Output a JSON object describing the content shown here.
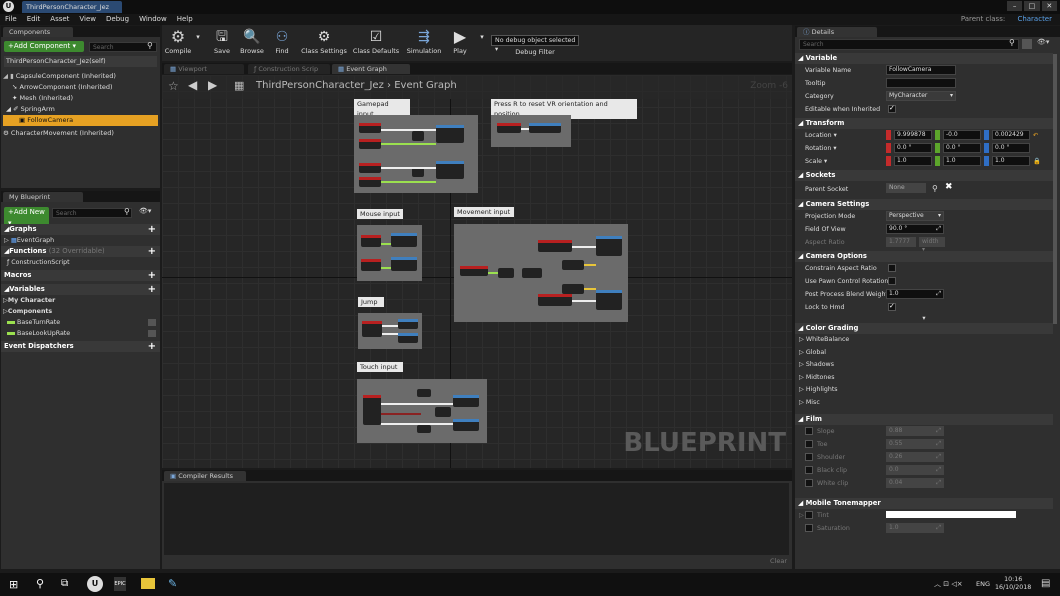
{
  "window": {
    "tab_title": "ThirdPersonCharacter_Jez",
    "parent_class_label": "Parent class:",
    "parent_class_value": "Character"
  },
  "menu": [
    "File",
    "Edit",
    "Asset",
    "View",
    "Debug",
    "Window",
    "Help"
  ],
  "components": {
    "tab": "Components",
    "add_button": "+Add Component ▾",
    "search_placeholder": "Search",
    "self": "ThirdPersonCharacter_Jez(self)",
    "items": [
      "CapsuleComponent (Inherited)",
      "ArrowComponent (Inherited)",
      "Mesh (Inherited)",
      "SpringArm",
      "FollowCamera",
      "CharacterMovement (Inherited)"
    ]
  },
  "blueprint": {
    "tab": "My Blueprint",
    "add_button": "+Add New ▾",
    "search_placeholder": "Search",
    "graphs": "Graphs",
    "event_graph": "EventGraph",
    "functions": "Functions",
    "functions_count": "(32 Overridable)",
    "construction_script": "ConstructionScript",
    "macros": "Macros",
    "variables": "Variables",
    "my_character": "My Character",
    "components": "Components",
    "var1": "BaseTurnRate",
    "var2": "BaseLookUpRate",
    "dispatchers": "Event Dispatchers"
  },
  "toolbar": {
    "compile": "Compile",
    "save": "Save",
    "browse": "Browse",
    "find": "Find",
    "class_settings": "Class Settings",
    "class_defaults": "Class Defaults",
    "simulation": "Simulation",
    "play": "Play",
    "debug_select": "No debug object selected ▾",
    "debug_filter": "Debug Filter"
  },
  "editor_tabs": [
    "Viewport",
    "Construction Scrip",
    "Event Graph"
  ],
  "graph": {
    "breadcrumb_root": "ThirdPersonCharacter_Jez",
    "breadcrumb_sep": "›",
    "breadcrumb_leaf": "Event Graph",
    "zoom": "Zoom -6",
    "watermark": "BLUEPRINT",
    "comments": [
      "Gamepad input",
      "Press R to reset VR orientation and position",
      "Mouse input",
      "Movement input",
      "Jump",
      "Touch input"
    ]
  },
  "compiler": {
    "tab": "Compiler Results",
    "clear": "Clear"
  },
  "details": {
    "tab": "Details",
    "search_placeholder": "Search",
    "variable": {
      "header": "Variable",
      "name_label": "Variable Name",
      "name_value": "FollowCamera",
      "tooltip_label": "Tooltip",
      "category_label": "Category",
      "category_value": "MyCharacter",
      "editable_label": "Editable when Inherited"
    },
    "transform": {
      "header": "Transform",
      "location": "Location ▾",
      "rotation": "Rotation ▾",
      "scale": "Scale ▾",
      "loc": [
        "9.999878",
        "-0.0",
        "0.002429"
      ],
      "rot": [
        "0.0 °",
        "0.0 °",
        "0.0 °"
      ],
      "scl": [
        "1.0",
        "1.0",
        "1.0"
      ]
    },
    "sockets": {
      "header": "Sockets",
      "parent_label": "Parent Socket",
      "parent_value": "None"
    },
    "camera_settings": {
      "header": "Camera Settings",
      "projection_label": "Projection Mode",
      "projection_value": "Perspective",
      "fov_label": "Field Of View",
      "fov_value": "90.0 °",
      "aspect_label": "Aspect Ratio",
      "aspect_value": "1.7777",
      "aspect_extra": "width ▾"
    },
    "camera_options": {
      "header": "Camera Options",
      "constrain": "Constrain Aspect Ratio",
      "pawn": "Use Pawn Control Rotation",
      "pp_label": "Post Process Blend Weight",
      "pp_value": "1.0",
      "lock": "Lock to Hmd"
    },
    "color_grading": {
      "header": "Color Grading",
      "items": [
        "WhiteBalance",
        "Global",
        "Shadows",
        "Midtones",
        "Highlights",
        "Misc"
      ]
    },
    "film": {
      "header": "Film",
      "items": [
        {
          "label": "Slope",
          "value": "0.88"
        },
        {
          "label": "Toe",
          "value": "0.55"
        },
        {
          "label": "Shoulder",
          "value": "0.26"
        },
        {
          "label": "Black clip",
          "value": "0.0"
        },
        {
          "label": "White clip",
          "value": "0.04"
        }
      ]
    },
    "tonemapper": {
      "header": "Mobile Tonemapper",
      "tint": "Tint",
      "saturation": "Saturation",
      "saturation_value": "1.0"
    }
  },
  "taskbar": {
    "lang": "ENG",
    "time": "10:16",
    "date": "16/10/2018"
  },
  "colors": {
    "accent": "#e6a123",
    "green": "#3d8a2f",
    "x": "#c42b2b",
    "y": "#5ca52b",
    "z": "#2f6ec4"
  }
}
